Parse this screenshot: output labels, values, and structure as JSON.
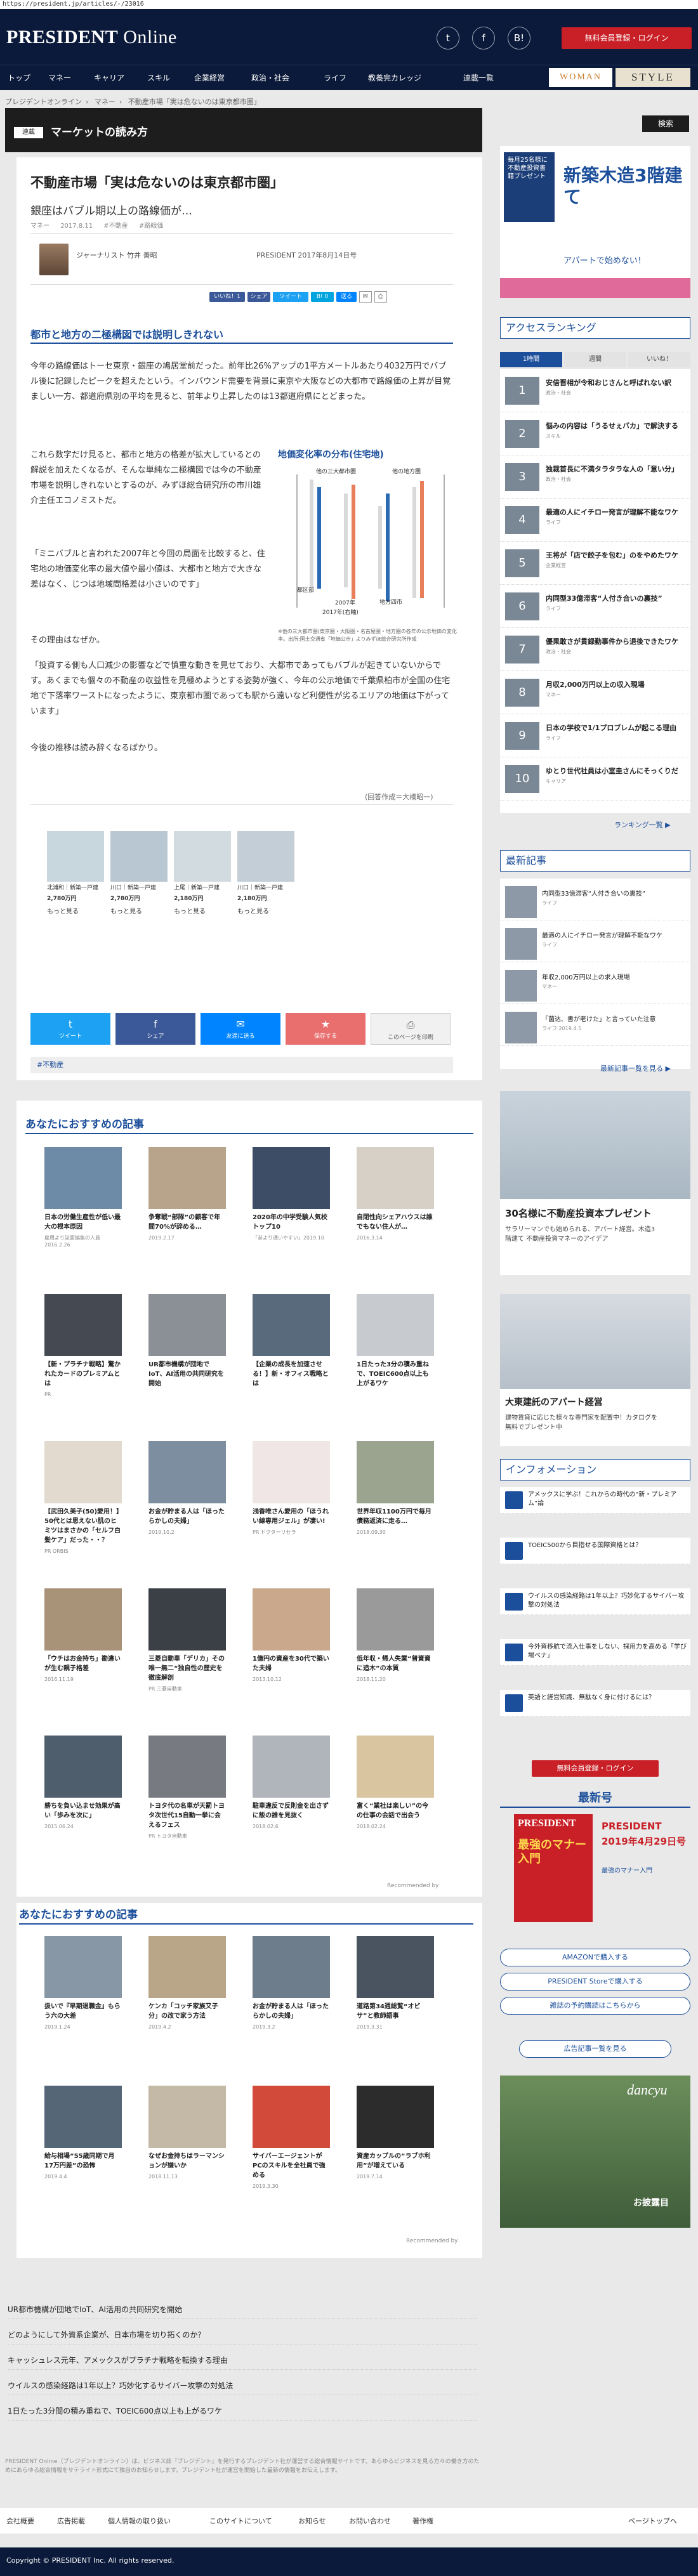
{
  "url": "https://president.jp/articles/-/23016",
  "header": {
    "logo_main": "PRESIDENT",
    "logo_sub": " Online",
    "sns": [
      "t",
      "f",
      "B!"
    ],
    "login_label": "無料会員登録・ログイン"
  },
  "nav": {
    "items": [
      "トップ",
      "マネー",
      "キャリア",
      "スキル",
      "企業経営",
      "政治・社会",
      "ライフ",
      "教養完カレッジ",
      "連載一覧"
    ],
    "woman": "WOMAN",
    "style": "STYLE"
  },
  "breadcrumb": [
    "プレジデントオンライン",
    "マネー",
    "不動産市場「実は危ないのは東京都市圏」"
  ],
  "section": {
    "tag": "連載",
    "title": "マーケットの読み方",
    "search": "検索"
  },
  "article": {
    "title": "不動産市場「実は危ないのは東京都市圏」",
    "subtitle": "銀座はバブル期以上の路線価が…",
    "meta_category": "マネー",
    "meta_date": "2017.8.11",
    "meta_tag1": "#不動産",
    "meta_tag2": "#路線価",
    "author": "ジャーナリスト 竹井 善昭",
    "pubdate": "PRESIDENT 2017年8月14日号",
    "share": [
      "いいね！1",
      "シェア",
      "ツイート",
      "B! 0",
      "送る"
    ],
    "lead_heading": "都市と地方の二極構図では説明しきれない",
    "p1": "今年の路線価はトーセ東京・銀座の鳩居堂前だった。前年比26%アップの1平方メートルあたり4032万円でバブル後に記録したピークを超えたという。インバウンド需要を背景に東京や大阪などの大都市で路線価の上昇が目覚ましい一方、都道府県別の平均を見ると、前年より上昇したのは13都道府県にとどまった。",
    "p2": "これら数字だけ見ると、都市と地方の格差が拡大しているとの解説を加えたくなるが、そんな単純な二極構図では今の不動産市場を説明しきれないとするのが、みずほ総合研究所の市川雄介主任エコノミストだ。",
    "p3": "「ミニバブルと言われた2007年と今回の局面を比較すると、住宅地の地価変化率の最大値や最小値は、大都市と地方で大きな差はなく、じつは地域間格差は小さいのです」",
    "p4": "その理由はなぜか。",
    "p5": "「投資する側も人口減少の影響などで慎重な動きを見せており、大都市であってもバブルが起きていないからです。あくまでも個々の不動産の収益性を見極めようとする姿勢が強く、今年の公示地価で千葉県柏市が全国の住宅地で下落率ワーストになったように、東京都市圏であっても駅から遠いなど利便性が劣るエリアの地価は下がっています」",
    "p6": "今後の推移は読み辞くなるばかり。",
    "chart_title": "地価変化率の分布(住宅地)",
    "chart_labels": [
      "他の三大都市圏",
      "他の地方圏",
      "都区部",
      "地方四市"
    ],
    "chart_years": [
      "2007年",
      "2017年(右軸)"
    ],
    "chart_note": "※他の三大都市圏(東京圏・大阪圏・名古屋圏・地方圏の各年の公示地価の変化率。出所:国土交通省「地価公示」よりみずほ総合研究所作成",
    "source_note": "(回答作成＝大橋昭一)",
    "tag": "#不動産",
    "bigshare": [
      "ツイート",
      "シェア",
      "友達に送る",
      "保存する",
      "このページを印刷"
    ]
  },
  "ads": [
    {
      "cap": "北浦和｜新築一戸建",
      "price": "2,780万円",
      "btn": "もっと見る"
    },
    {
      "cap": "川口｜新築一戸建",
      "price": "2,780万円",
      "btn": "もっと見る"
    },
    {
      "cap": "上尾｜新築一戸建",
      "price": "2,180万円",
      "btn": "もっと見る"
    },
    {
      "cap": "川口｜新築一戸建",
      "price": "2,180万円",
      "btn": "もっと見る"
    }
  ],
  "rec": {
    "heading": "あなたにおすすめの記事",
    "items": [
      {
        "title": "日本の労働生産性が低い最大の根本原因",
        "sub": "雇用より誌面編集の人員 2016.2.26"
      },
      {
        "title": "争奪戦“部隊”の顧客で年間70%が辞める…",
        "sub": "2019.2.17"
      },
      {
        "title": "2020年の中学受験人気校トップ10",
        "sub": "「昔より通いやすい」2019.10"
      },
      {
        "title": "自閉性向シェアハウスは誰でもない住人が…",
        "sub": "2016.3.14"
      },
      {
        "title": "【新・プラチナ戦略】驚かれたカードのプレミアムとは",
        "sub": "PR"
      },
      {
        "title": "UR都市機構が団地でIoT、AI活用の共同研究を開始",
        "sub": ""
      },
      {
        "title": "【企業の成長を加速させる！】新・オフィス戦略とは",
        "sub": ""
      },
      {
        "title": "1日たった3分の積み重ねで、TOEIC600点以上も上がるワケ",
        "sub": ""
      },
      {
        "title": "【武田久美子(50)愛用！】50代とは思えない肌のヒミツはまさかの「セルフ白髪ケア」だった・・？",
        "sub": "PR ORBIS"
      },
      {
        "title": "お金が貯まる人は「ほったらかしの夫婦」",
        "sub": "2019.10.2"
      },
      {
        "title": "浅香唯さん愛用の「ほうれい線専用ジェル」が凄い!",
        "sub": "PR ドクターリセラ"
      },
      {
        "title": "世界年収1100万円で毎月債務返済に走る…",
        "sub": "2018.09.30"
      },
      {
        "title": "「ウチはお金持ち」勘違いが生む親子格差",
        "sub": "2016.11.19"
      },
      {
        "title": "三菱自動車「デリカ」その唯一無二“独自性の歴史を徹底解剖",
        "sub": "PR 三菱自動車"
      },
      {
        "title": "1億円の資産を30代で築いた夫婦",
        "sub": "2013.10.12"
      },
      {
        "title": "低年収・帰人失業“普資資に追木”の本質",
        "sub": "2018.11.20"
      },
      {
        "title": "勝ちを負い込ませ効果が高い「歩みを次に」",
        "sub": "2015.06.24"
      },
      {
        "title": "トヨタ代の名車が天罰トヨタ次世代15自動一挙に会えるフェス",
        "sub": "PR トヨタ自動車"
      },
      {
        "title": "駐車違反で反則金を出さずに飯の誰を見抜く",
        "sub": "2018.02.6"
      },
      {
        "title": "富く“業社は楽しい”の今の仕事の会話で出会う",
        "sub": "2018.02.24"
      }
    ],
    "recommended_by": "Recommended by"
  },
  "rec2": {
    "heading": "あなたにおすすめの記事",
    "items": [
      {
        "title": "扱いで『早期退職金』もらう六の大差",
        "sub": "2019.1.24"
      },
      {
        "title": "ケンカ「コッチ家族又子分」の改で家う方法",
        "sub": "2019.4.2"
      },
      {
        "title": "お金が貯まる人は「ほったらかしの夫婦」",
        "sub": "2019.3.2"
      },
      {
        "title": "道路第34週総覧“オビサ”と教師語事",
        "sub": "2019.3.31"
      },
      {
        "title": "給与相場“55歳同期で月17万円差”の恐怖",
        "sub": "2019.4.4"
      },
      {
        "title": "なぜお金持ちはラーマンションが嫌いか",
        "sub": "2018.11.13"
      },
      {
        "title": "サイバーエージェントがPCのスキルを全社員で強める",
        "sub": "2019.3.30"
      },
      {
        "title": "資産カップルの“ラブホ利用”が増えている",
        "sub": "2019.7.14"
      }
    ],
    "recommended_by": "Recommended by"
  },
  "links": [
    "UR都市機構が団地でIoT、AI活用の共同研究を開始",
    "どのようにして外資系企業が、日本市場を切り拓くのか？",
    "キャッシュレス元年、アメックスがプラチナ戦略を転換する理由",
    "ウイルスの感染経路は1年以上？巧妙化するサイバー攻撃の対処法",
    "1日たった3分間の積み重ねで、TOEIC600点以上も上がるワケ"
  ],
  "footer_note": "PRESIDENT Online（プレジデントオンライン）は、ビジネス誌『プレジデント』を発行するプレジデント社が運営する総合情報サイトです。あらゆるビジネスを見る方々の働き方のためにあらゆる総合情報をサテライト形式にて独自のお知らせします。プレジデント社が運営を開始した最新の情報をお伝えします。",
  "footer_links": [
    "会社概要",
    "広告掲載",
    "個人情報の取り扱い",
    "このサイトについて",
    "お知らせ",
    "お問い合わせ",
    "著作権"
  ],
  "page_top": "ページトップへ",
  "copyright": "Copyright © PRESIDENT Inc. All rights reserved.",
  "sidebar": {
    "ad_top_label": "毎月25名様に不動産投資書籍プレゼント",
    "ad_top_big": "新築木造3階建て",
    "ad_top_sub": "アパートで始めない！",
    "ranking_heading": "アクセスランキング",
    "rank_tabs": [
      "1時間",
      "週間",
      "いいね！"
    ],
    "ranking": [
      {
        "n": "1",
        "title": "安倍晋相が令和おじさんと呼ばれない訳",
        "cat": "政治・社会"
      },
      {
        "n": "2",
        "title": "悩みの内容は「うるせぇバカ」で解決する",
        "cat": "スキル"
      },
      {
        "n": "3",
        "title": "独裁首長に不満タラタラな人の「意い分」",
        "cat": "政治・社会"
      },
      {
        "n": "4",
        "title": "最適の人にイチロー発言が理解不能なワケ",
        "cat": "ライフ"
      },
      {
        "n": "5",
        "title": "王将が「店で餃子を包む」のをやめたワケ",
        "cat": "企業経営"
      },
      {
        "n": "6",
        "title": "内同型33億滞客“人付き合いの裏技”",
        "cat": "ライフ"
      },
      {
        "n": "7",
        "title": "優果敢さが貫録勤事件から退後できたワケ",
        "cat": "政治・社会"
      },
      {
        "n": "8",
        "title": "月収2,000万円以上の収入現場",
        "cat": "マネー"
      },
      {
        "n": "9",
        "title": "日本の学校で1/1プロブレムが起こる理由",
        "cat": "ライフ"
      },
      {
        "n": "10",
        "title": "ゆとり世代社員は小室圭さんにそっくりだ",
        "cat": "キャリア"
      }
    ],
    "ranking_more": "ランキング一覧 ▶",
    "latest_heading": "最新記事",
    "latest": [
      {
        "title": "内同型33億滞客“人付き合いの裏技”",
        "cat": "ライフ"
      },
      {
        "title": "最適の人にイチロー発言が理解不能なワケ",
        "cat": "ライフ"
      },
      {
        "title": "年収2,000万円以上の求人現場",
        "cat": "マネー"
      },
      {
        "title": "「菌达、書が老けた」と言っていた注意",
        "cat": "ライフ 2019.4.5"
      }
    ],
    "latest_more": "最新記事一覧を見る ▶",
    "ad2_title": "30名様に不動産投資本プレゼント",
    "ad2_text": "サラリーマンでも始められる、アパート経営。木造3階建て 不動産投資マネーのアイデア",
    "ad3_title": "大東建託のアパート経営",
    "ad3_text": "建物賃貸に応じた様々な専門家を配置中！カタログを無料でプレゼント中",
    "info_heading": "インフォメーション",
    "info": [
      "アメックスに学ぶ！これからの時代の“新・プレミアム”論",
      "TOEIC500から目指せる国際資格とは？",
      "ウイルスの感染経路は1年以上？巧妙化するサイバー攻撃の対処法",
      "今外資移航で流入仕事をしない、採用力を高める「学び場ベナ」",
      "英語と経営知識、無駄なく身に付けるには？"
    ],
    "info_btn": "無料会員登録・ログイン",
    "latest_issue_heading": "最新号",
    "issue_cover_title": "PRESIDENT",
    "issue_cover_big": "最強のマナー入門",
    "issue_name": "PRESIDENT",
    "issue_date": "2019年4月29日号",
    "issue_sub": "最強のマナー入門",
    "buy_amazon": "AMAZONで購入する",
    "buy_store": "PRESIDENT Storeで購入する",
    "buy_subscribe": "雑誌の予約購読はこちらから",
    "ad_list": "広告記事一覧を見る",
    "dancyu": "dancyu",
    "dancyu_sub": "お披露目"
  },
  "chart_data": {
    "type": "scatter",
    "title": "地価変化率の分布(住宅地)",
    "series": [
      {
        "name": "2007年"
      },
      {
        "name": "2017年(右軸)"
      }
    ],
    "categories": [
      "都区部",
      "他の三大都市圏",
      "地方四市",
      "他の地方圏"
    ]
  }
}
